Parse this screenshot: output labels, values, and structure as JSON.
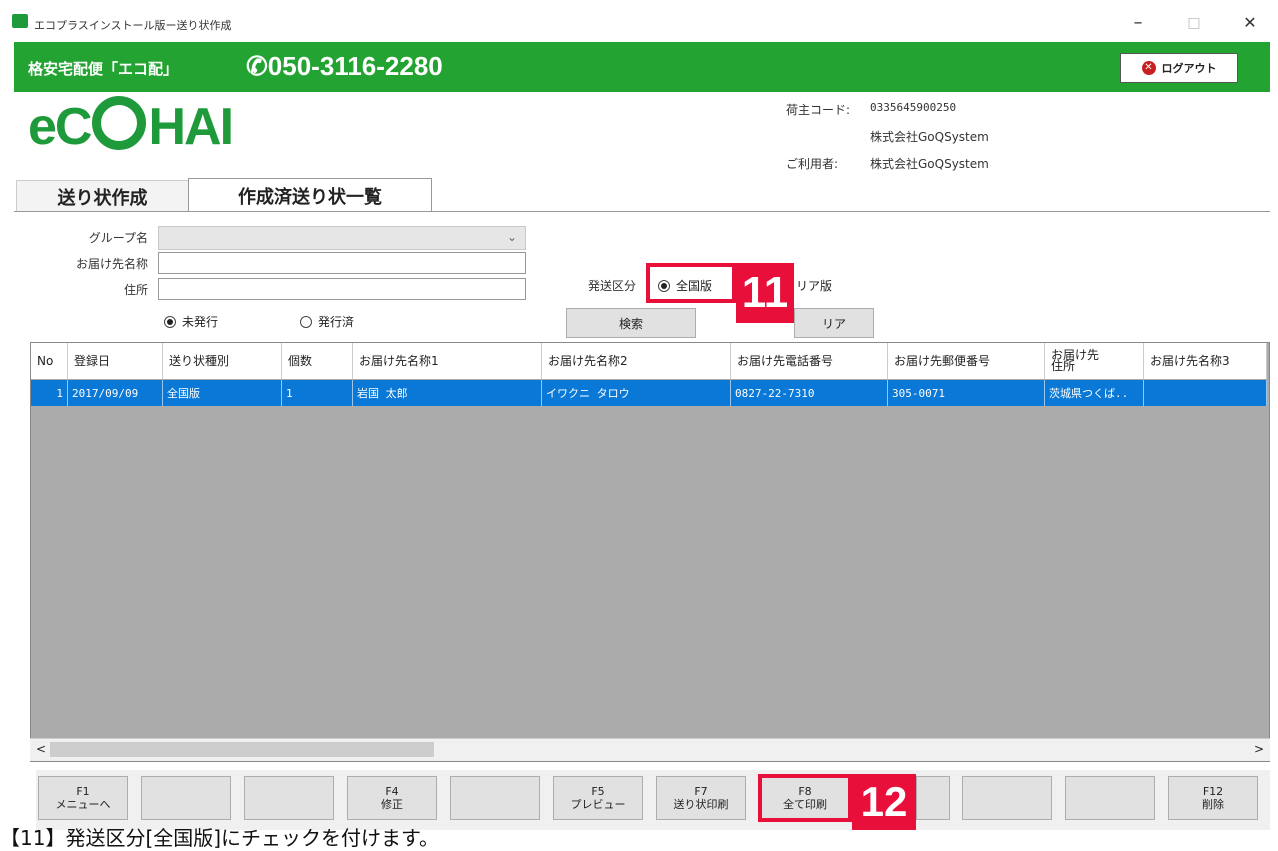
{
  "window": {
    "title": "エコプラスインストール版ー送り状作成",
    "minimize": "–",
    "maximize": "□",
    "close": "✕"
  },
  "header": {
    "service_name": "格安宅配便「エコ配」",
    "phone": "050-3116-2280",
    "logout_label": "ログアウト",
    "brand_color": "#23a331"
  },
  "logo": {
    "left": "eC",
    "right": "HAI"
  },
  "shipper": {
    "code_label": "荷主コード:",
    "code_value": "0335645900250",
    "company": "株式会社GoQSystem",
    "user_label": "ご利用者:",
    "user_value": "株式会社GoQSystem"
  },
  "tabs": [
    {
      "label": "送り状作成",
      "active": false
    },
    {
      "label": "作成済送り状一覧",
      "active": true
    }
  ],
  "form": {
    "group_label": "グループ名",
    "group_value": "",
    "recipient_label": "お届け先名称",
    "recipient_value": "",
    "address_label": "住所",
    "address_value": "",
    "status_options": [
      {
        "label": "未発行",
        "checked": true
      },
      {
        "label": "発行済",
        "checked": false
      }
    ],
    "ship_type_label": "発送区分",
    "ship_type_options": [
      {
        "label": "全国版",
        "checked": true
      },
      {
        "label": "エリア版",
        "visible_text": "リア版",
        "checked": false
      }
    ],
    "search_button": "検索",
    "clear_button": "リア",
    "clear_button_visible": "リア"
  },
  "grid": {
    "columns": [
      "No",
      "登録日",
      "送り状種別",
      "個数",
      "お届け先名称1",
      "お届け先名称2",
      "お届け先電話番号",
      "お届け先郵便番号",
      "お届け先\n住所",
      "お届け先名称3"
    ],
    "rows": [
      [
        "1",
        "2017/09/09",
        "全国版",
        "1",
        "岩国 太郎",
        "イワクニ タロウ",
        "0827-22-7310",
        "305-0071",
        "茨城県つくば..",
        ""
      ]
    ],
    "selected_color": "#0a78d7",
    "scroll_left": "<",
    "scroll_right": ">"
  },
  "fkeys": [
    {
      "key": "F1",
      "label": "メニューへ"
    },
    {
      "key": "",
      "label": ""
    },
    {
      "key": "",
      "label": ""
    },
    {
      "key": "F4",
      "label": "修正"
    },
    {
      "key": "",
      "label": ""
    },
    {
      "key": "F5",
      "label": "プレビュー"
    },
    {
      "key": "F7",
      "label": "送り状印刷"
    },
    {
      "key": "F8",
      "label": "全て印刷"
    },
    {
      "key": "",
      "label": ""
    },
    {
      "key": "",
      "label": ""
    },
    {
      "key": "",
      "label": ""
    },
    {
      "key": "F12",
      "label": "削除"
    }
  ],
  "annotations": {
    "marker11": "11",
    "marker12": "12",
    "marker_color": "#e8103a"
  },
  "caption": "【11】発送区分[全国版]にチェックを付けます。"
}
